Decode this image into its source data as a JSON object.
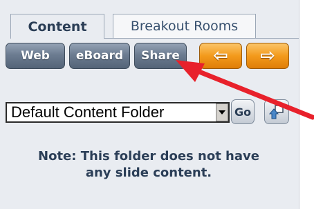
{
  "tabs": [
    {
      "label": "Content",
      "active": true
    },
    {
      "label": "Breakout Rooms",
      "active": false
    }
  ],
  "toolbar": {
    "web_label": "Web",
    "eboard_label": "eBoard",
    "share_label": "Share",
    "back_icon": "arrow-left-icon",
    "forward_icon": "arrow-right-icon"
  },
  "folder": {
    "selected": "Default Content Folder",
    "go_label": "Go",
    "up_icon": "folder-up-icon"
  },
  "note": {
    "line1": "Note: This folder does not have",
    "line2": "any slide content."
  },
  "colors": {
    "panel_bg": "#e9ecf1",
    "gray_button": "#6c7c91",
    "orange_button": "#f39a1c",
    "callout_arrow": "#e8212b",
    "note_text": "#2b3e57"
  }
}
